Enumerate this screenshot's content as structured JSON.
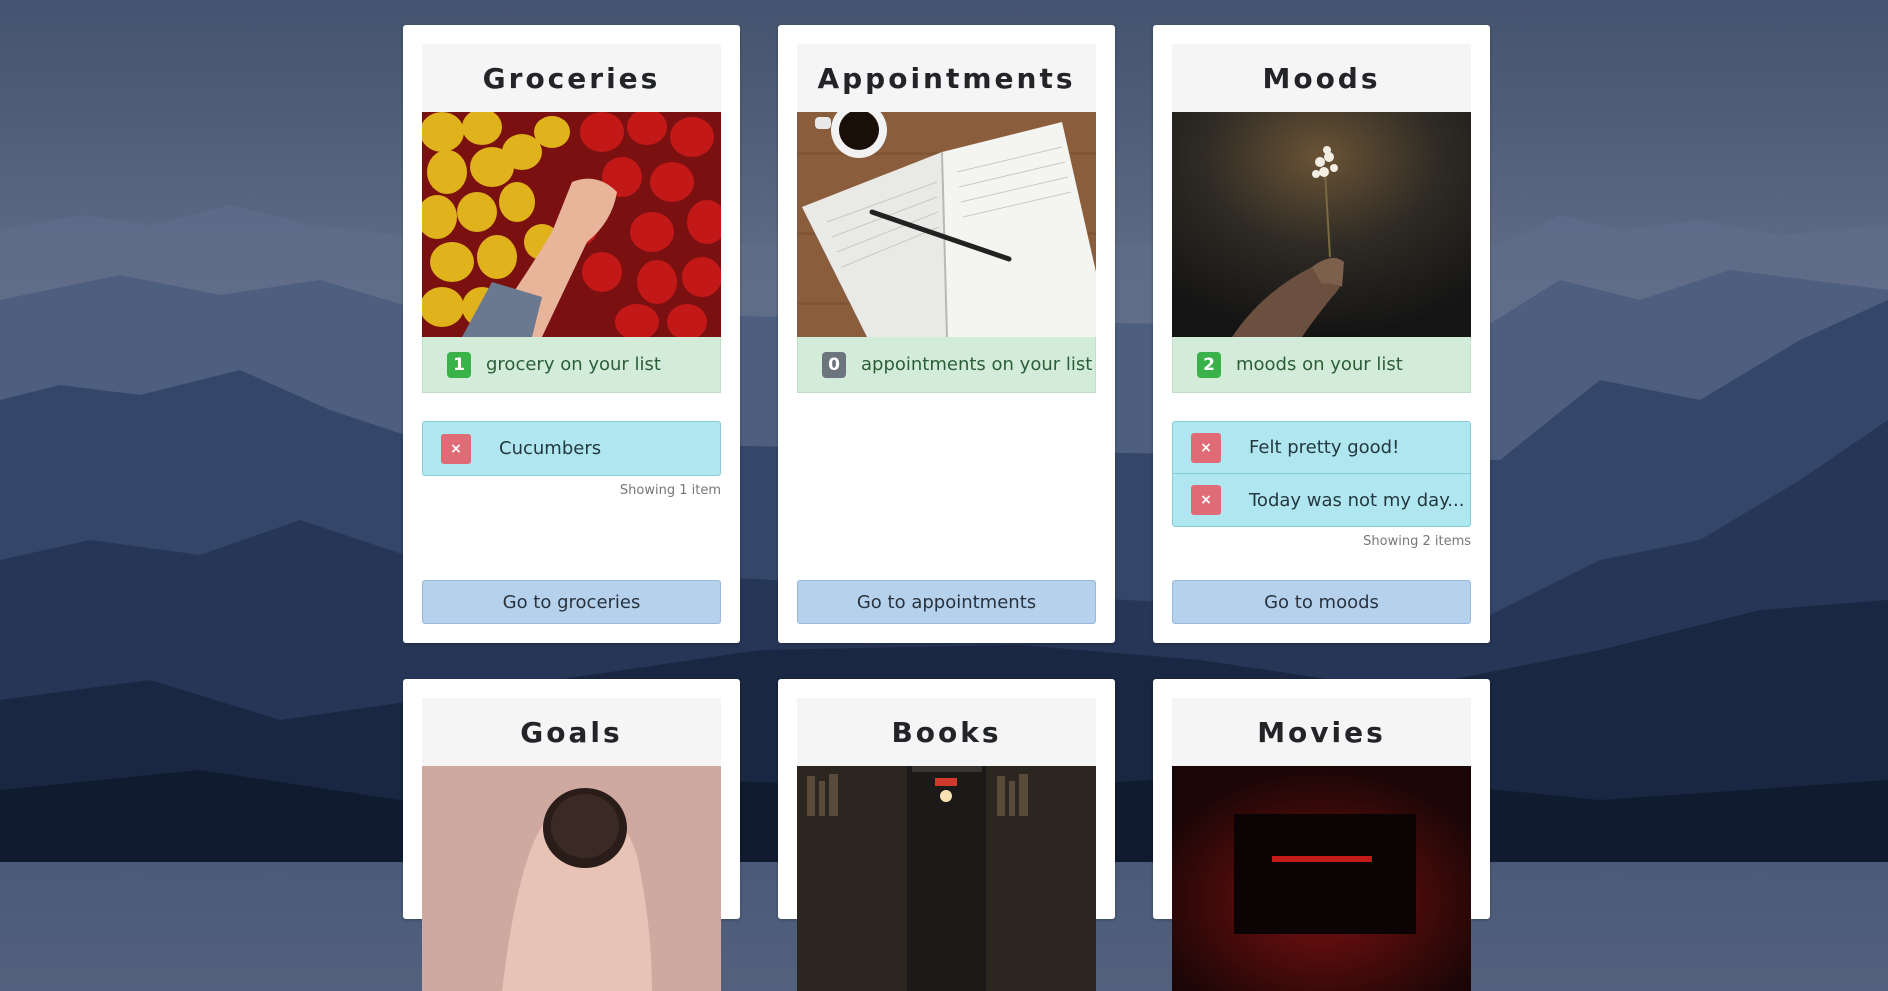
{
  "colors": {
    "badge_green": "#38b249",
    "badge_gray": "#6c757d",
    "count_bar_bg": "#d3ecd9",
    "list_item_bg": "#b0e6ef",
    "delete_button": "#de6b75",
    "go_button_bg": "#b5d1ec"
  },
  "cards": [
    {
      "title": "Groceries",
      "count": "1",
      "count_text": "grocery on your list",
      "items": [
        "Cucumbers"
      ],
      "showing": "Showing 1 item",
      "button": "Go to groceries"
    },
    {
      "title": "Appointments",
      "count": "0",
      "count_text": "appointments on your list",
      "items": [],
      "showing": "",
      "button": "Go to appointments"
    },
    {
      "title": "Moods",
      "count": "2",
      "count_text": "moods on your list",
      "items": [
        "Felt pretty good!",
        "Today was not my day..."
      ],
      "showing": "Showing 2 items",
      "button": "Go to moods"
    },
    {
      "title": "Goals"
    },
    {
      "title": "Books"
    },
    {
      "title": "Movies"
    }
  ],
  "delete_icon": "×",
  "icons": {
    "delete": "close-icon"
  }
}
